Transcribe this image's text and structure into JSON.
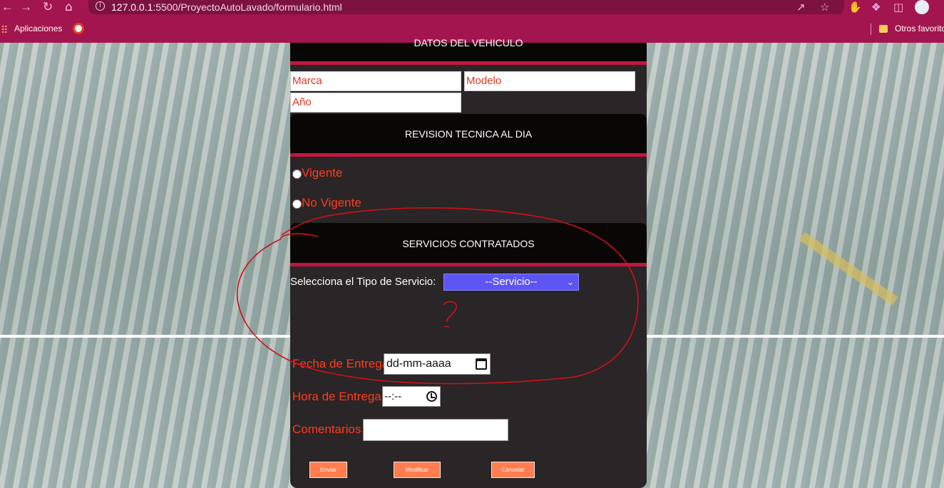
{
  "browser": {
    "url_host": "127.0.0.1",
    "url_path": ":5500/ProyectoAutoLavado/formulario.html",
    "bookmarks": {
      "apps_label": "Aplicaciones",
      "other_label": "Otros favoritos"
    },
    "icons": [
      "back-arrow-icon",
      "forward-arrow-icon",
      "reload-icon",
      "home-icon",
      "info-icon",
      "share-icon",
      "star-icon",
      "extension-hand-icon",
      "puzzle-icon",
      "side-panel-icon",
      "profile-avatar-icon"
    ]
  },
  "form": {
    "vehicle_section_title": "DATOS DEL VEHICULO",
    "fields": {
      "marca_placeholder": "Marca",
      "modelo_placeholder": "Modelo",
      "anio_placeholder": "Año"
    },
    "revision_section_title": "REVISION TECNICA AL DIA",
    "radio_options": [
      "Vigente",
      "No Vigente"
    ],
    "services_section_title": "SERVICIOS CONTRATADOS",
    "service_label": "Selecciona el Tipo de Servicio:",
    "service_selected": "--Servicio--",
    "delivery_date_label": "Fecha de Entrega",
    "delivery_date_value": "dd-mm-aaaa",
    "delivery_time_label": "Hora de Entrega",
    "delivery_time_value": "--:--",
    "comments_label": "Comentarios",
    "buttons": {
      "submit": "Enviar",
      "modify": "Modificar",
      "cancel": "Cancelar"
    }
  },
  "colors": {
    "browser_bar": "#a3154e",
    "panel": "#2a2526",
    "section_header": "#090606",
    "accent_bar": "#c4163d",
    "label_text": "#ff3b1f",
    "select_bg": "#5c54f3",
    "button_bg": "#ff7d4e",
    "annotation": "#d0101a"
  },
  "annotation": {
    "shape": "hand-drawn red ellipse with question mark",
    "mark": "?"
  }
}
